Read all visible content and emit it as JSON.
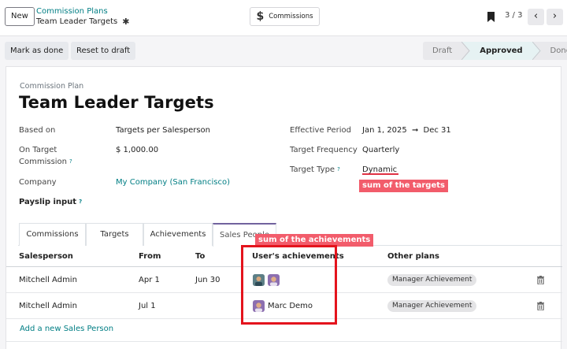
{
  "topbar": {
    "new_label": "New",
    "breadcrumb_parent": "Commission Plans",
    "breadcrumb_current": "Team Leader Targets",
    "smart_button_label": "Commissions",
    "pager": "3 / 3"
  },
  "actions": {
    "mark_done": "Mark as done",
    "reset_draft": "Reset to draft"
  },
  "statusbar": [
    {
      "label": "Draft",
      "active": false
    },
    {
      "label": "Approved",
      "active": true
    },
    {
      "label": "Done",
      "active": false
    }
  ],
  "form": {
    "overline": "Commission Plan",
    "title": "Team Leader Targets",
    "based_on_label": "Based on",
    "based_on_value": "Targets per Salesperson",
    "on_target_label_1": "On Target",
    "on_target_label_2": "Commission",
    "on_target_value": "$ 1,000.00",
    "company_label": "Company",
    "company_value": "My Company (San Francisco)",
    "payslip_label": "Payslip input",
    "effective_label": "Effective Period",
    "effective_from": "Jan 1, 2025",
    "effective_to": "Dec 31",
    "frequency_label": "Target Frequency",
    "frequency_value": "Quarterly",
    "target_type_label": "Target Type",
    "target_type_value": "Dynamic",
    "help_mark": "?"
  },
  "annotations": {
    "targets": "sum of the targets",
    "achievements": "sum of the achievements"
  },
  "tabs": [
    {
      "label": "Commissions",
      "active": false
    },
    {
      "label": "Targets",
      "active": false
    },
    {
      "label": "Achievements",
      "active": false
    },
    {
      "label": "Sales People",
      "active": true
    }
  ],
  "table": {
    "columns": [
      "Salesperson",
      "From",
      "To",
      "User's achievements",
      "Other plans"
    ],
    "rows": [
      {
        "salesperson": "Mitchell Admin",
        "from": "Apr 1",
        "to": "Jun 30",
        "achievement_user": "",
        "other_plan": "Manager Achievement"
      },
      {
        "salesperson": "Mitchell Admin",
        "from": "Jul 1",
        "to": "",
        "achievement_user": "Marc Demo",
        "other_plan": "Manager Achievement"
      }
    ],
    "add_line": "Add a new Sales Person"
  },
  "colors": {
    "accent": "#017e84",
    "annotation": "#f25c6b",
    "highlight_box": "#e4141d",
    "active_tab": "#71639e"
  }
}
